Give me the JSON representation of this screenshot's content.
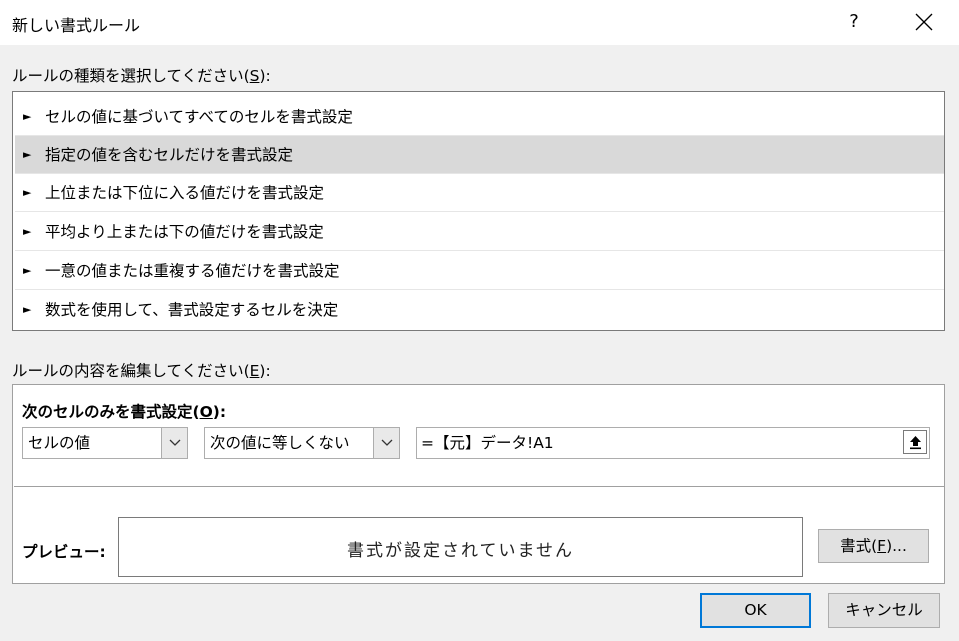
{
  "window": {
    "title": "新しい書式ルール",
    "help": "?",
    "close": "✕"
  },
  "rule_type": {
    "label_prefix": "ルールの種類を選択してください(",
    "label_key": "S",
    "label_suffix": "):",
    "items": [
      {
        "label": "セルの値に基づいてすべてのセルを書式設定",
        "selected": false
      },
      {
        "label": "指定の値を含むセルだけを書式設定",
        "selected": true
      },
      {
        "label": "上位または下位に入る値だけを書式設定",
        "selected": false
      },
      {
        "label": "平均より上または下の値だけを書式設定",
        "selected": false
      },
      {
        "label": "一意の値または重複する値だけを書式設定",
        "selected": false
      },
      {
        "label": "数式を使用して、書式設定するセルを決定",
        "selected": false
      }
    ],
    "arrow_glyph": "►"
  },
  "edit": {
    "label_prefix": "ルールの内容を編集してください(",
    "label_key": "E",
    "label_suffix": "):",
    "format_only_prefix": "次のセルのみを書式設定(",
    "format_only_key": "O",
    "format_only_suffix": "):",
    "condition_type": "セルの値",
    "operator": "次の値に等しくない",
    "formula": "=【元】データ!A1",
    "preview_label": "プレビュー:",
    "preview_text": "書式が設定されていません",
    "format_button_prefix": "書式(",
    "format_button_key": "F",
    "format_button_suffix": ")..."
  },
  "buttons": {
    "ok": "OK",
    "cancel": "キャンセル"
  },
  "colors": {
    "accent": "#0078d7",
    "selected_row": "#d9d9d9",
    "dialog_bg": "#f0f0f0"
  }
}
